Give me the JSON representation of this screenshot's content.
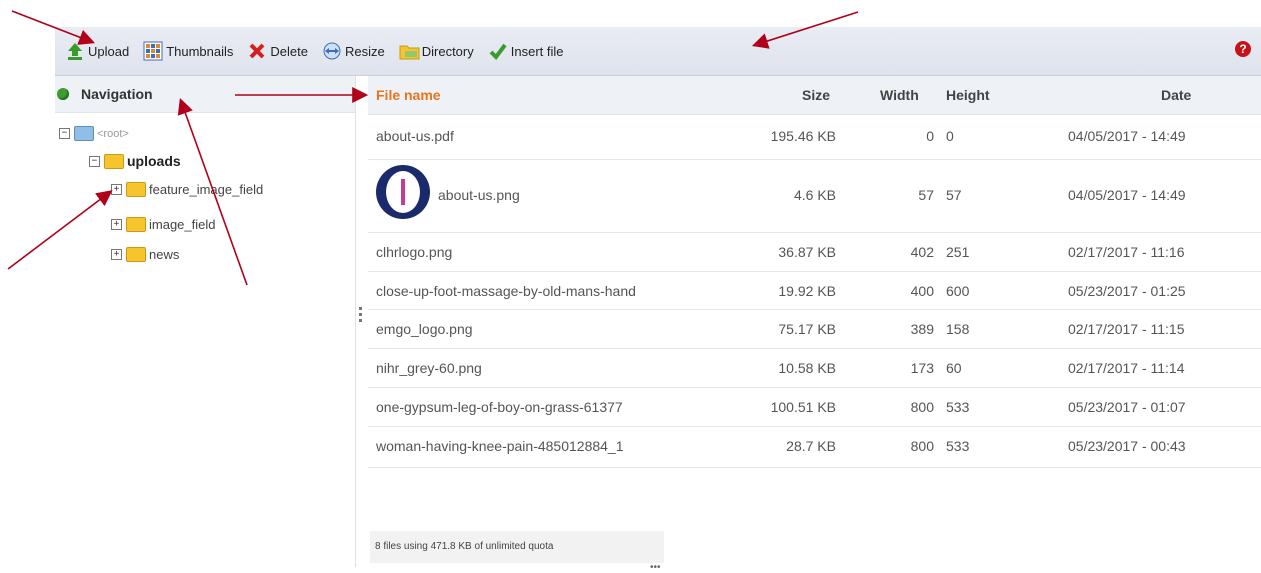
{
  "toolbar": {
    "upload": "Upload",
    "thumbnails": "Thumbnails",
    "delete": "Delete",
    "resize": "Resize",
    "directory": "Directory",
    "insert_file": "Insert file",
    "help": "?"
  },
  "nav": {
    "title": "Navigation",
    "tree": {
      "root": "<root>",
      "uploads": "uploads",
      "children": [
        "feature_image_field",
        "image_field",
        "news"
      ]
    }
  },
  "files": {
    "headers": {
      "name": "File name",
      "size": "Size",
      "width": "Width",
      "height": "Height",
      "date": "Date"
    },
    "rows": [
      {
        "name": "about-us.pdf",
        "size": "195.46 KB",
        "width": "0",
        "height": "0",
        "date": "04/05/2017 - 14:49"
      },
      {
        "name": "about-us.png",
        "size": "4.6 KB",
        "width": "57",
        "height": "57",
        "date": "04/05/2017 - 14:49"
      },
      {
        "name": "clhrlogo.png",
        "size": "36.87 KB",
        "width": "402",
        "height": "251",
        "date": "02/17/2017 - 11:16"
      },
      {
        "name": "close-up-foot-massage-by-old-mans-hand",
        "size": "19.92 KB",
        "width": "400",
        "height": "600",
        "date": "05/23/2017 - 01:25"
      },
      {
        "name": "emgo_logo.png",
        "size": "75.17 KB",
        "width": "389",
        "height": "158",
        "date": "02/17/2017 - 11:15"
      },
      {
        "name": "nihr_grey-60.png",
        "size": "10.58 KB",
        "width": "173",
        "height": "60",
        "date": "02/17/2017 - 11:14"
      },
      {
        "name": "one-gypsum-leg-of-boy-on-grass-61377",
        "size": "100.51 KB",
        "width": "800",
        "height": "533",
        "date": "05/23/2017 - 01:07"
      },
      {
        "name": "woman-having-knee-pain-485012884_1",
        "size": "28.7 KB",
        "width": "800",
        "height": "533",
        "date": "05/23/2017 - 00:43"
      }
    ],
    "status": "8 files using 471.8 KB of unlimited quota"
  },
  "colors": {
    "accent": "#e8741c",
    "arrow": "#b0001a",
    "toolbar_bg": "#e3e7ef"
  }
}
